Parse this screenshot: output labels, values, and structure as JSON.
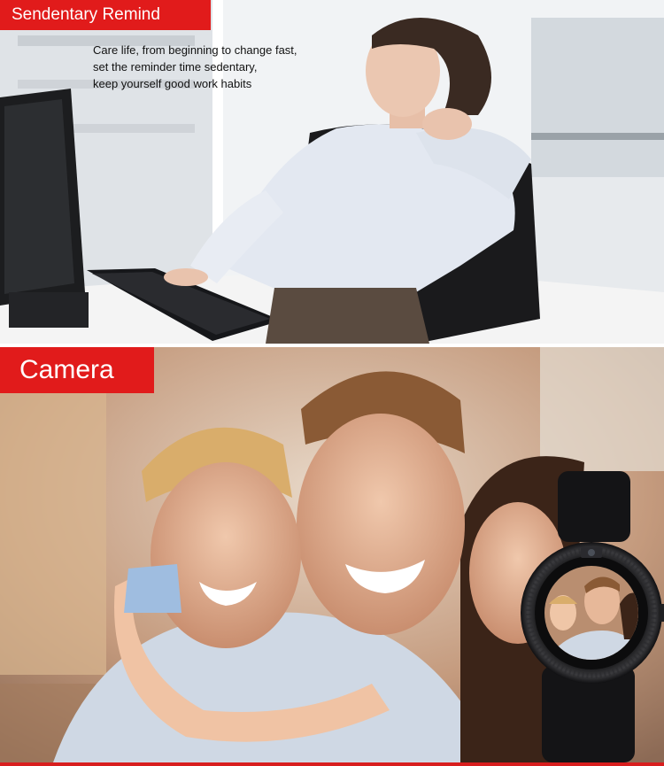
{
  "sections": [
    {
      "id": "sedentary",
      "tag": "Sendentary Remind",
      "caption_lines": [
        "Care life, from beginning to change fast,",
        "set the reminder time sedentary,",
        "keep yourself good work habits"
      ]
    },
    {
      "id": "camera",
      "tag": "Camera"
    }
  ],
  "colors": {
    "tag_bg": "#e11b1b",
    "tag_text": "#ffffff",
    "caption_text": "#111111"
  }
}
